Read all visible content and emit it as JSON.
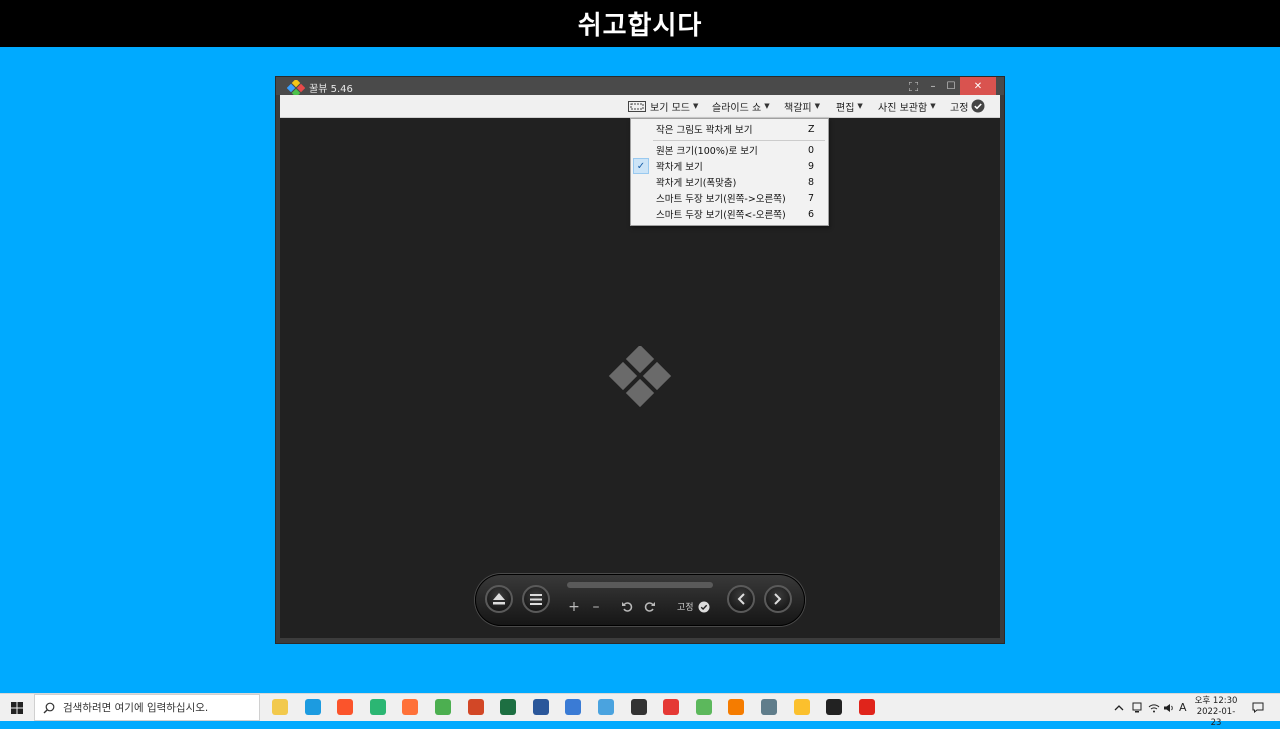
{
  "banner": {
    "title": "쉬고합시다"
  },
  "window": {
    "title": "꿀뷰 5.46",
    "close_glyph": "✕",
    "minimize_glyph": "–",
    "maximize_glyph": "☐"
  },
  "menu": {
    "items": [
      {
        "label": "보기 모드"
      },
      {
        "label": "슬라이드 쇼"
      },
      {
        "label": "책갈피"
      },
      {
        "label": "편집"
      },
      {
        "label": "사진 보관함"
      }
    ],
    "pin_label": "고정"
  },
  "view_menu": {
    "items": [
      {
        "label": "작은 그림도 꽉차게 보기",
        "key": "Z",
        "checked": false
      },
      {
        "label": "원본 크기(100%)로 보기",
        "key": "0",
        "checked": false
      },
      {
        "label": "꽉차게 보기",
        "key": "9",
        "checked": true
      },
      {
        "label": "꽉차게 보기(폭맞춤)",
        "key": "8",
        "checked": false
      },
      {
        "label": "스마트 두장 보기(왼쪽->오른쪽)",
        "key": "7",
        "checked": false
      },
      {
        "label": "스마트 두장 보기(왼쪽<-오른쪽)",
        "key": "6",
        "checked": false
      }
    ]
  },
  "controls": {
    "pin_label": "고정",
    "zoom_in_glyph": "+",
    "zoom_out_glyph": "–"
  },
  "taskbar": {
    "search_placeholder": "검색하려면 여기에 입력하십시오.",
    "clock_time": "오후 12:30",
    "clock_date": "2022-01-23",
    "ime_label": "A",
    "pinned_apps": [
      {
        "icon": "file-explorer-icon",
        "color": "#f2c94c"
      },
      {
        "icon": "edge-icon",
        "color": "#1c9be0"
      },
      {
        "icon": "brave-icon",
        "color": "#fb542b"
      },
      {
        "icon": "app-green-icon",
        "color": "#2bb673"
      },
      {
        "icon": "firefox-icon",
        "color": "#ff7139"
      },
      {
        "icon": "chrome-icon",
        "color": "#4caf50"
      },
      {
        "icon": "powerpoint-icon",
        "color": "#d24726"
      },
      {
        "icon": "excel-icon",
        "color": "#1d6f42"
      },
      {
        "icon": "word-icon",
        "color": "#2b579a"
      },
      {
        "icon": "hwp-icon",
        "color": "#3a7bd5"
      },
      {
        "icon": "remote-icon",
        "color": "#4aa3df"
      },
      {
        "icon": "search-app-icon",
        "color": "#333333"
      },
      {
        "icon": "se-icon",
        "color": "#e53935"
      },
      {
        "icon": "download-icon",
        "color": "#5cb85c"
      },
      {
        "icon": "vlc-icon",
        "color": "#f57c00"
      },
      {
        "icon": "calculator-icon",
        "color": "#607d8b"
      },
      {
        "icon": "chrome-canary-icon",
        "color": "#fbc02d"
      },
      {
        "icon": "sticky-notes-icon",
        "color": "#222222"
      },
      {
        "icon": "opera-icon",
        "color": "#e0241b"
      }
    ]
  }
}
